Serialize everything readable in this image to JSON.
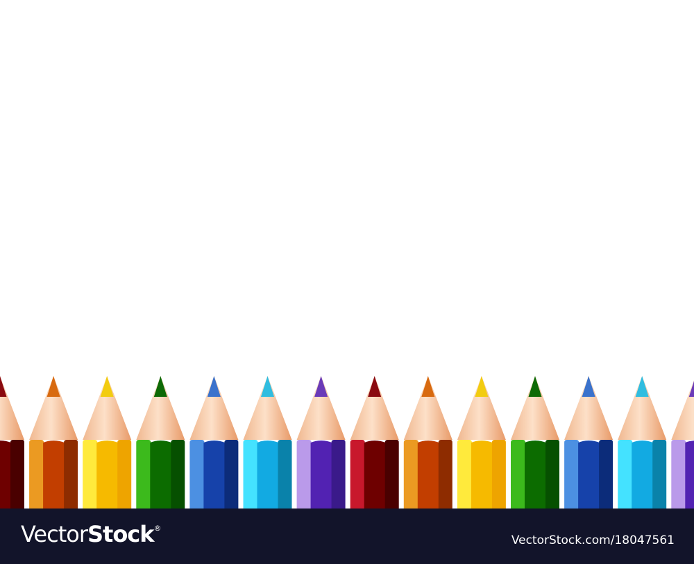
{
  "pencil_colors": [
    {
      "name": "red",
      "light": "#c8182c",
      "mid": "#6e0000",
      "dark": "#4a0000",
      "tip": "#8a0a10"
    },
    {
      "name": "orange",
      "light": "#eb9a22",
      "mid": "#c23e00",
      "dark": "#8e2c00",
      "tip": "#d86a10"
    },
    {
      "name": "yellow",
      "light": "#ffea3c",
      "mid": "#f6ba00",
      "dark": "#eea400",
      "tip": "#f2cc10"
    },
    {
      "name": "green",
      "light": "#3cba1c",
      "mid": "#0c6c00",
      "dark": "#065000",
      "tip": "#0e6a06"
    },
    {
      "name": "blue",
      "light": "#4c90e2",
      "mid": "#1642aa",
      "dark": "#0c2c7a",
      "tip": "#3a72cc"
    },
    {
      "name": "cyan",
      "light": "#44e2ff",
      "mid": "#12aae2",
      "dark": "#0a82aa",
      "tip": "#30bde0"
    },
    {
      "name": "purple",
      "light": "#ba9aea",
      "mid": "#5222b2",
      "dark": "#3a1a8a",
      "tip": "#6a3ab8"
    }
  ],
  "pencil_count": 14,
  "footer": {
    "logo_thin": "Vector",
    "logo_bold": "Stock",
    "logo_mark": "®",
    "url": "VectorStock.com/18047561"
  }
}
